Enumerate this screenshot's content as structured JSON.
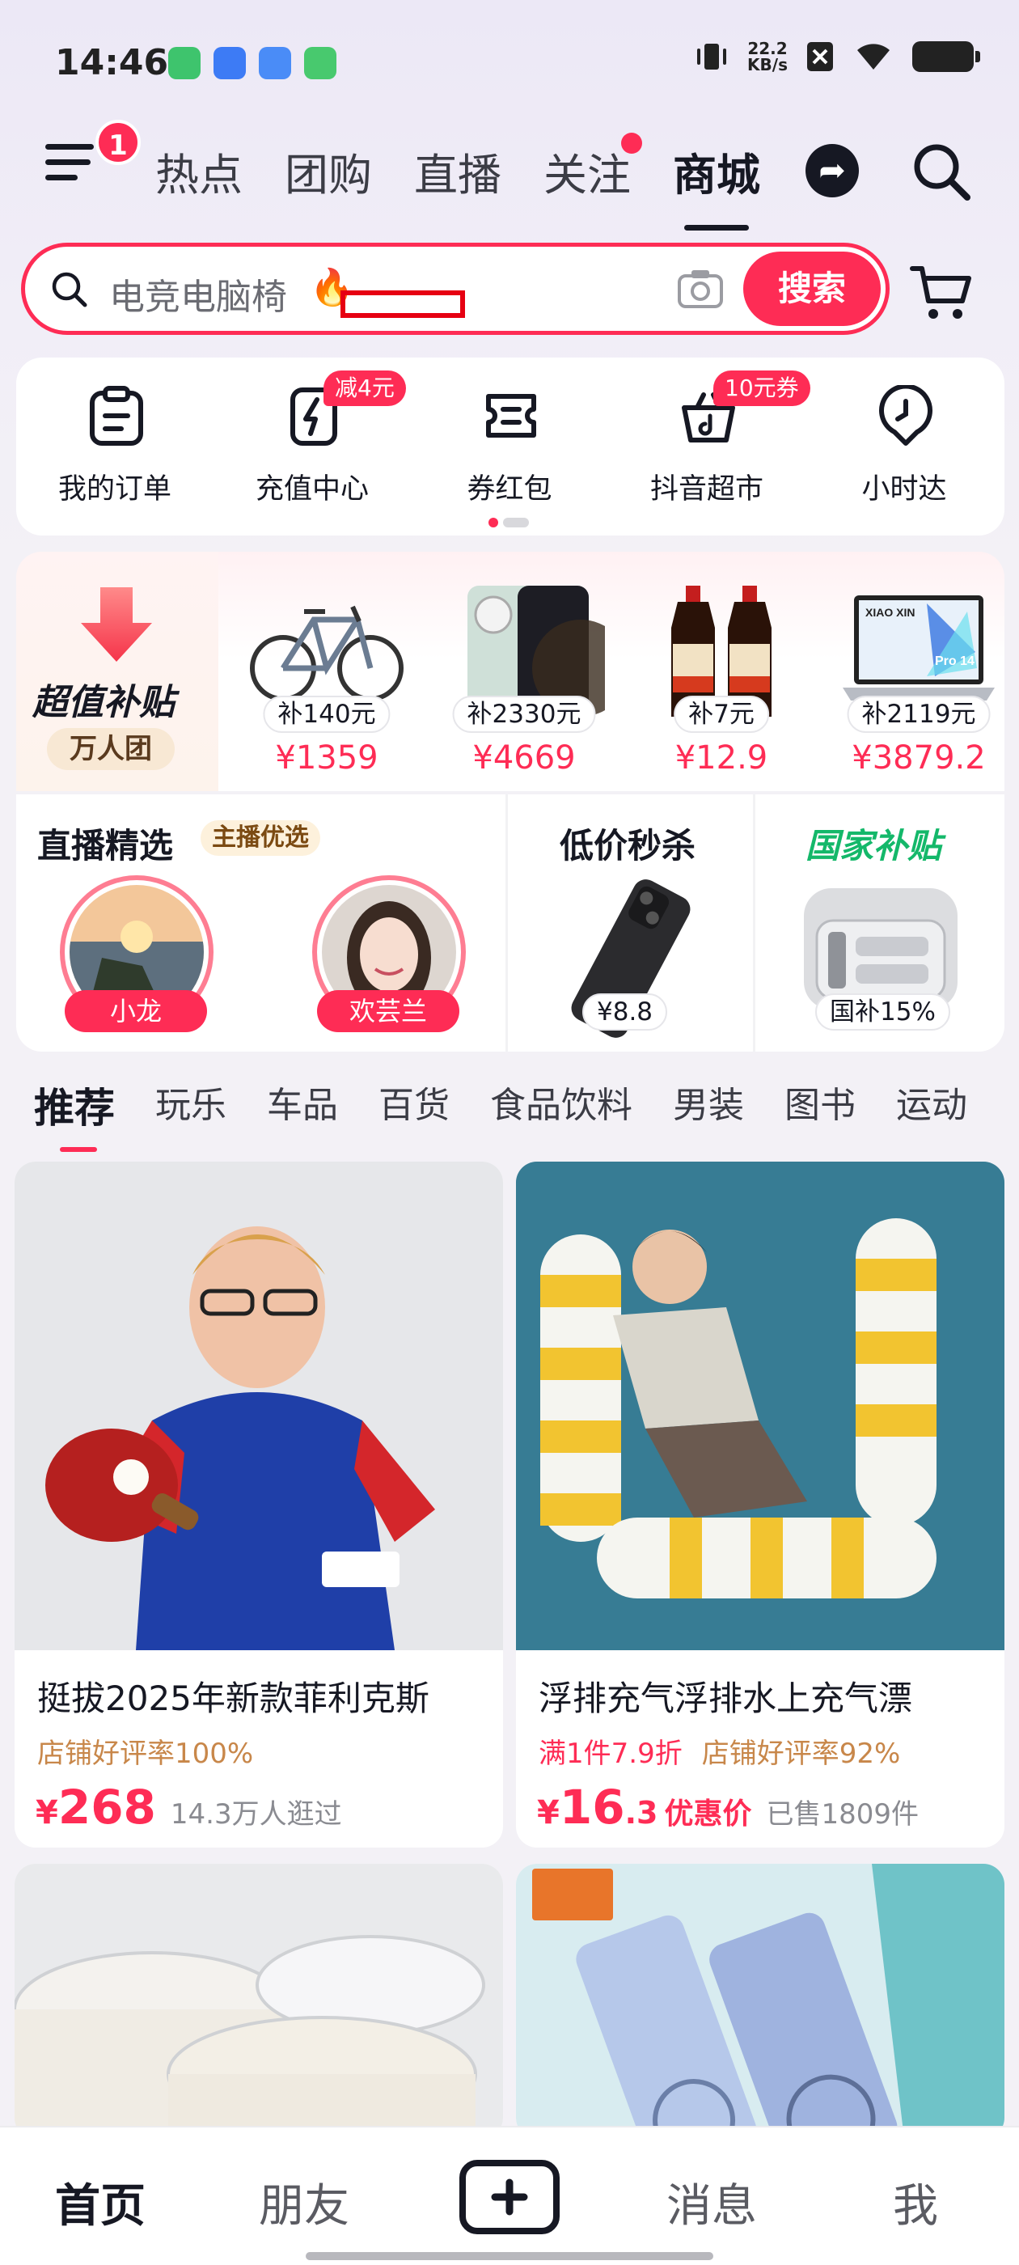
{
  "status_bar": {
    "time": "14:46",
    "net_speed_value": "22.2",
    "net_speed_unit": "KB/s"
  },
  "top_nav": {
    "menu_badge": "1",
    "tabs": [
      {
        "label": "热点"
      },
      {
        "label": "团购"
      },
      {
        "label": "直播"
      },
      {
        "label": "关注"
      },
      {
        "label": "商城"
      }
    ],
    "active_tab": "商城"
  },
  "search": {
    "query": "电竞电脑椅",
    "button_label": "搜索"
  },
  "quick_entries": [
    {
      "label": "我的订单",
      "icon": "clipboard-icon",
      "tag": ""
    },
    {
      "label": "充值中心",
      "icon": "lightning-phone-icon",
      "tag": "减4元"
    },
    {
      "label": "券红包",
      "icon": "coupon-icon",
      "tag": ""
    },
    {
      "label": "抖音超市",
      "icon": "basket-icon",
      "tag": "10元券"
    },
    {
      "label": "小时达",
      "icon": "clock-pin-icon",
      "tag": ""
    }
  ],
  "subsidy": {
    "title": "超值补贴",
    "badge": "万人团",
    "items": [
      {
        "name": "bicycle",
        "subsidy": "补140元",
        "price": "¥1359"
      },
      {
        "name": "phone",
        "subsidy": "补2330元",
        "price": "¥4669"
      },
      {
        "name": "soy-sauce",
        "subsidy": "补7元",
        "price": "¥12.9"
      },
      {
        "name": "laptop",
        "subsidy": "补2119元",
        "price": "¥3879.2"
      }
    ]
  },
  "sections": {
    "live": {
      "title": "直播精选",
      "tag": "主播优选",
      "hosts": [
        {
          "name": "小龙"
        },
        {
          "name": "欢芸兰"
        }
      ]
    },
    "flash": {
      "title": "低价秒杀",
      "price": "¥8.8"
    },
    "gov": {
      "title": "国家补贴",
      "tag": "国补15%"
    }
  },
  "category_tabs": [
    "推荐",
    "玩乐",
    "车品",
    "百货",
    "食品饮料",
    "男装",
    "图书",
    "运动"
  ],
  "products": [
    {
      "title": "挺拔2025年新款菲利克斯",
      "discount": "",
      "rating": "店铺好评率100%",
      "yen": "¥",
      "price": "268",
      "price_suffix": "",
      "price_tag": "",
      "sub": "14.3万人逛过"
    },
    {
      "title": "浮排充气浮排水上充气漂",
      "discount": "满1件7.9折",
      "rating": "店铺好评率92%",
      "yen": "¥",
      "price": "16",
      "price_suffix": ".3",
      "price_tag": "优惠价",
      "sub": "已售1809件"
    }
  ],
  "bottom_nav": {
    "items": [
      "首页",
      "朋友",
      "消息",
      "我"
    ],
    "active": "首页"
  },
  "colors": {
    "accent": "#fe2c55",
    "gov_green": "#14b86a",
    "rating_gold": "#c8874a"
  }
}
